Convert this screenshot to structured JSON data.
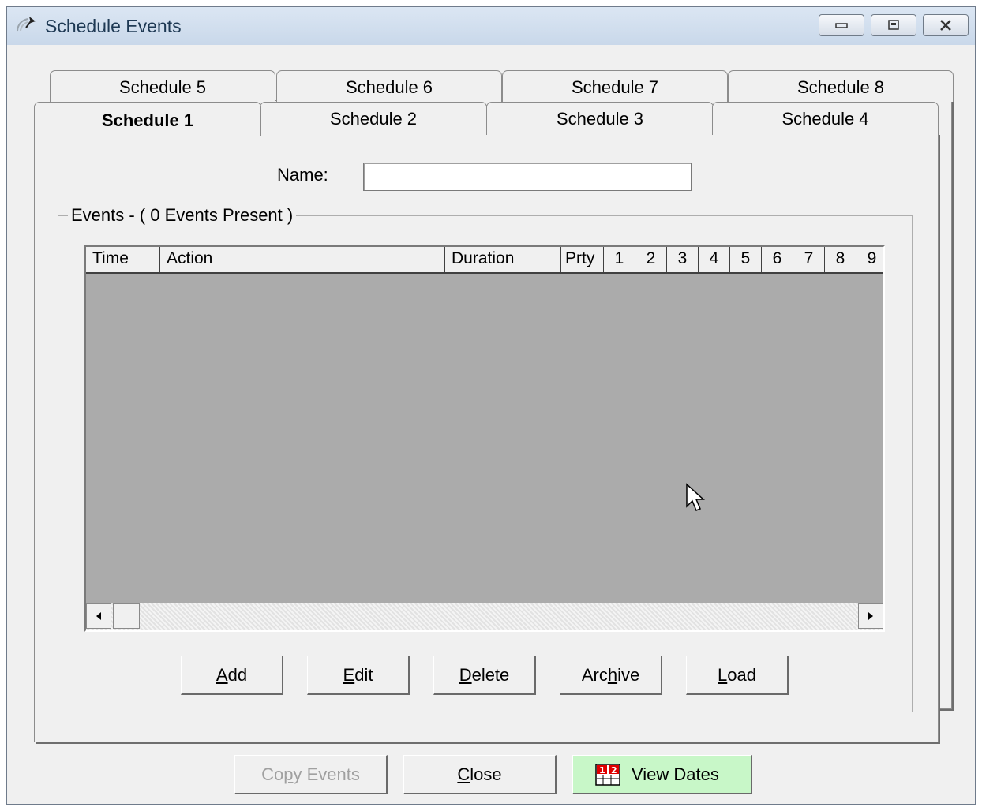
{
  "window": {
    "title": "Schedule Events"
  },
  "tabs_back": [
    "Schedule 5",
    "Schedule 6",
    "Schedule 7",
    "Schedule 8"
  ],
  "tabs_front": [
    "Schedule 1",
    "Schedule 2",
    "Schedule 3",
    "Schedule 4"
  ],
  "active_tab": "Schedule 1",
  "name": {
    "label": "Name:",
    "value": ""
  },
  "events": {
    "legend": "Events - ( 0 Events Present )",
    "columns": [
      "Time",
      "Action",
      "Duration",
      "Prty",
      "1",
      "2",
      "3",
      "4",
      "5",
      "6",
      "7",
      "8",
      "9"
    ]
  },
  "buttons": {
    "add": {
      "pre": "",
      "key": "A",
      "post": "dd"
    },
    "edit": {
      "pre": "",
      "key": "E",
      "post": "dit"
    },
    "delete": {
      "pre": "",
      "key": "D",
      "post": "elete"
    },
    "archive": {
      "pre": "Arc",
      "key": "h",
      "post": "ive"
    },
    "load": {
      "pre": "",
      "key": "L",
      "post": "oad"
    },
    "copy_events": {
      "pre": "Co",
      "key": "p",
      "post": "y Events"
    },
    "close": {
      "pre": "",
      "key": "C",
      "post": "lose"
    },
    "view_dates": {
      "label": "View Dates",
      "icon_text": "1 2"
    }
  },
  "colors": {
    "view_dates_bg": "#c8f7c8",
    "grid_bg": "#ababab",
    "window_bg": "#f0f0f0"
  },
  "icons": [
    "satellite-dish-icon",
    "minimize-icon",
    "restore-icon",
    "close-icon",
    "arrow-left-icon",
    "arrow-right-icon",
    "calendar-icon",
    "mouse-cursor-icon"
  ]
}
